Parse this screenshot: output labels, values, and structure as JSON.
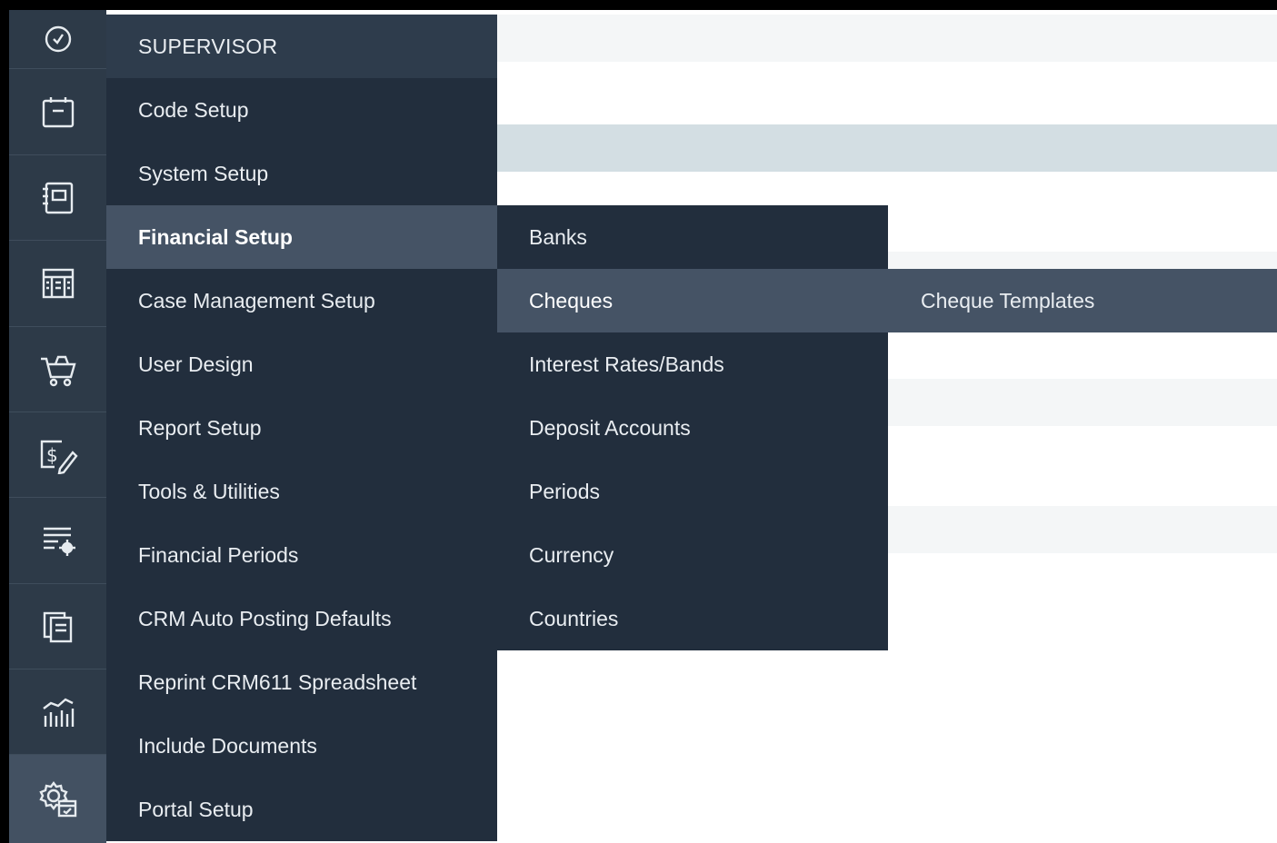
{
  "rail": {
    "icons": [
      "clock-icon",
      "calendar-icon",
      "notebook-icon",
      "building-icon",
      "cart-icon",
      "dollar-edit-icon",
      "list-settings-icon",
      "documents-icon",
      "chart-icon",
      "settings-calendar-icon"
    ]
  },
  "menu": {
    "header": "SUPERVISOR",
    "items": [
      "Code Setup",
      "System Setup",
      "Financial Setup",
      "Case Management Setup",
      "User Design",
      "Report Setup",
      "Tools & Utilities",
      "Financial Periods",
      "CRM Auto Posting Defaults",
      "Reprint CRM611 Spreadsheet",
      "Include Documents",
      "Portal Setup"
    ]
  },
  "financial_submenu": {
    "items": [
      "Banks",
      "Cheques",
      "Interest Rates/Bands",
      "Deposit Accounts",
      "Periods",
      "Currency",
      "Countries"
    ]
  },
  "cheques_submenu": {
    "items": [
      "Cheque Templates"
    ]
  },
  "colors": {
    "rail_bg": "#2d3a48",
    "menu_bg": "#222e3d",
    "active_bg": "#455365",
    "text": "#e9edf1"
  }
}
